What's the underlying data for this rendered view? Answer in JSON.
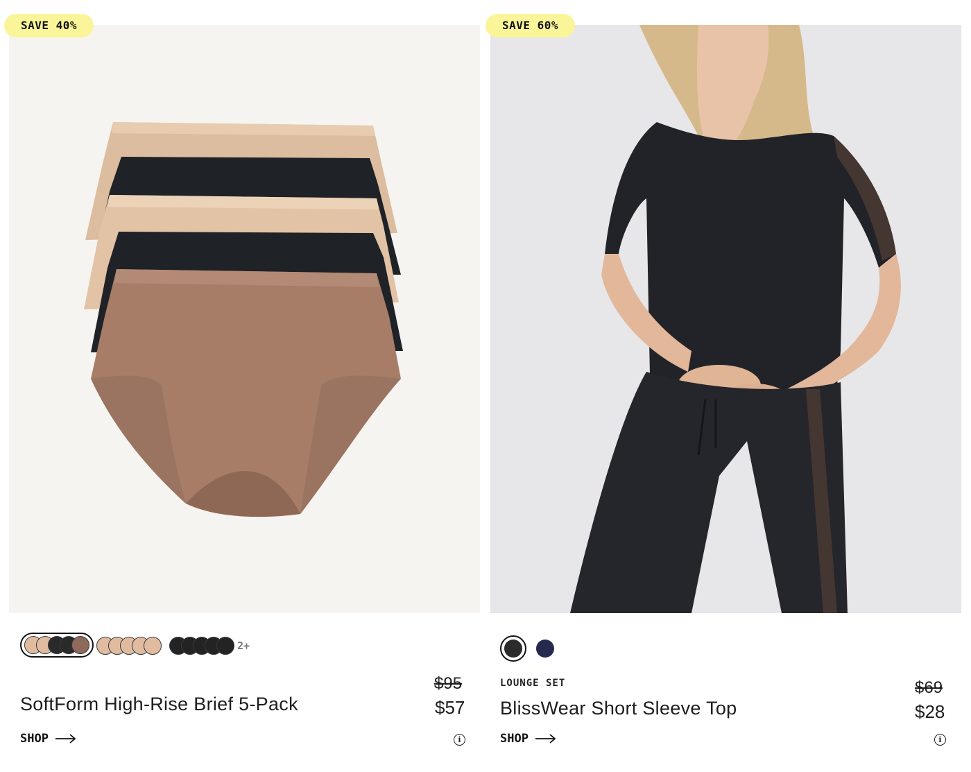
{
  "products": [
    {
      "badge": "SAVE 40%",
      "category": "",
      "name": "SoftForm High-Rise Brief 5-Pack",
      "original_price": "$95",
      "sale_price": "$57",
      "shop_label": "SHOP",
      "info_glyph": "i",
      "more_colors_label": "2+",
      "swatch_groups": [
        {
          "selected": true,
          "colors": [
            "#e1bba0",
            "#e1bba0",
            "#2a2a2a",
            "#2a2a2a",
            "#8f6a5a"
          ]
        },
        {
          "selected": false,
          "colors": [
            "#e1bba0",
            "#e1bba0",
            "#e1bba0",
            "#e1bba0",
            "#e1bba0"
          ]
        },
        {
          "selected": false,
          "colors": [
            "#232323",
            "#232323",
            "#232323",
            "#232323",
            "#232323"
          ]
        }
      ],
      "image_icon": "underwear-stack-image"
    },
    {
      "badge": "SAVE 60%",
      "category": "LOUNGE SET",
      "name": "BlissWear Short Sleeve Top",
      "original_price": "$69",
      "sale_price": "$28",
      "shop_label": "SHOP",
      "info_glyph": "i",
      "swatches": [
        {
          "selected": true,
          "color": "#2b2b2b"
        },
        {
          "selected": false,
          "color": "#232a4d"
        }
      ],
      "image_icon": "model-lounge-top-image"
    }
  ],
  "colors": {
    "badge_bg": "#fbf59a",
    "text": "#1d1d1d"
  }
}
